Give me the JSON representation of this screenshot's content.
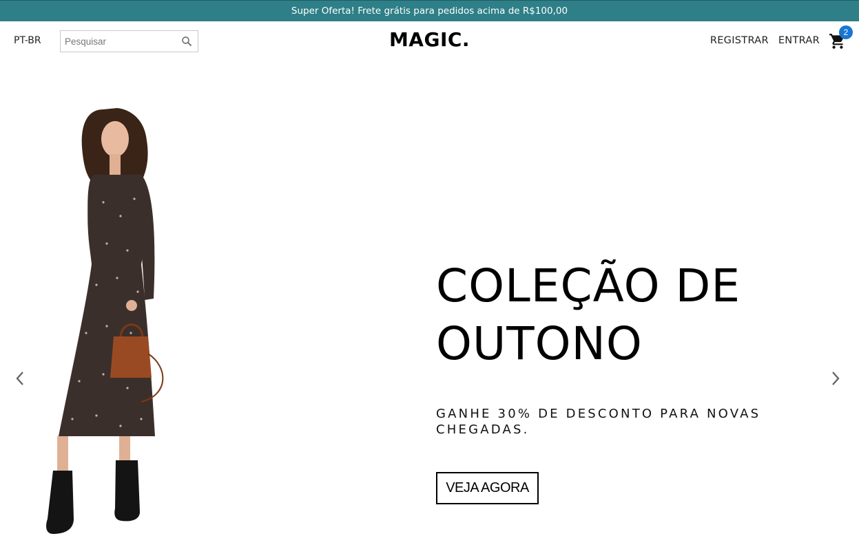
{
  "announcement": {
    "text": "Super Oferta! Frete grátis para pedidos acima de R$100,00"
  },
  "header": {
    "language": "PT-BR",
    "search": {
      "placeholder": "Pesquisar",
      "value": ""
    },
    "logo": "MAGIC.",
    "links": {
      "register": "REGISTRAR",
      "login": "ENTRAR"
    },
    "cart_count": "2"
  },
  "hero": {
    "title_line1": "COLEÇÃO DE",
    "title_line2": "OUTONO",
    "subtitle": "GANHE 30% DE DESCONTO PARA NOVAS CHEGADAS.",
    "cta": "VEJA AGORA"
  },
  "colors": {
    "announcement_bg": "#2e7f87",
    "cart_badge": "#1976d2",
    "text": "#000000"
  },
  "icons": [
    "search-icon",
    "cart-icon",
    "chevron-left-icon",
    "chevron-right-icon"
  ]
}
